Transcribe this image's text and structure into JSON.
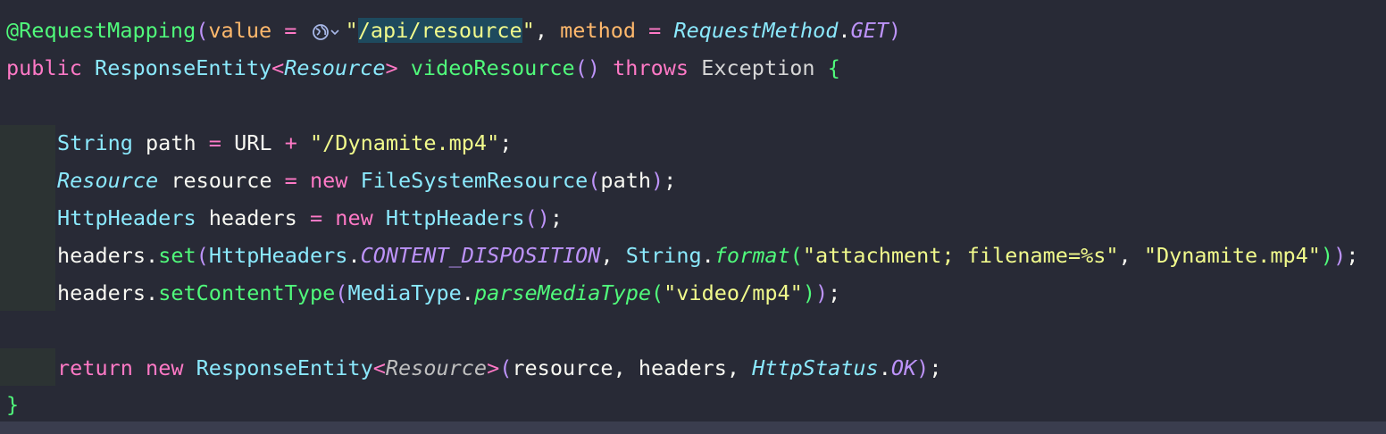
{
  "code": {
    "l1": {
      "annotation": "@RequestMapping",
      "open": "(",
      "p1": "value",
      "eq1": " = ",
      "q1": "\"",
      "path": "/api/resource",
      "q2": "\"",
      "comma": ", ",
      "p2": "method",
      "eq2": " = ",
      "enum": "RequestMethod",
      "dot": ".",
      "get": "GET",
      "close": ")"
    },
    "l2": {
      "pub": "public ",
      "resp": "ResponseEntity",
      "lt": "<",
      "res": "Resource",
      "gt": ">",
      "sp": " ",
      "name": "videoResource",
      "parens": "()",
      "throws": " throws ",
      "exc": "Exception ",
      "brace": "{"
    },
    "l3": {
      "type": "String",
      "var": " path ",
      "eq": "=",
      "url": " URL ",
      "plus": "+",
      "sp": " ",
      "str": "\"/Dynamite.mp4\"",
      "semi": ";"
    },
    "l4": {
      "type": "Resource",
      "var": " resource ",
      "eq": "=",
      "sp": " ",
      "new": "new",
      "sp2": " ",
      "cls": "FileSystemResource",
      "open": "(",
      "arg": "path",
      "close": ")",
      "semi": ";"
    },
    "l5": {
      "type": "HttpHeaders",
      "var": " headers ",
      "eq": "=",
      "sp": " ",
      "new": "new",
      "sp2": " ",
      "cls": "HttpHeaders",
      "parens": "()",
      "semi": ";"
    },
    "l6": {
      "obj": "headers",
      "dot": ".",
      "fn": "set",
      "open": "(",
      "cls": "HttpHeaders",
      "dot2": ".",
      "const": "CONTENT_DISPOSITION",
      "comma": ", ",
      "str": "String",
      "dot3": ".",
      "fmt": "format",
      "open2": "(",
      "s1": "\"attachment; filename=%s\"",
      "comma2": ", ",
      "s2": "\"Dynamite.mp4\"",
      "close2": ")",
      "close": ")",
      "semi": ";"
    },
    "l7": {
      "obj": "headers",
      "dot": ".",
      "fn": "setContentType",
      "open": "(",
      "cls": "MediaType",
      "dot2": ".",
      "pm": "parseMediaType",
      "open2": "(",
      "s1": "\"video/mp4\"",
      "close2": ")",
      "close": ")",
      "semi": ";"
    },
    "l9": {
      "ret": "return",
      "sp": " ",
      "new": "new",
      "sp2": " ",
      "cls": "ResponseEntity",
      "lt": "<",
      "gen": "Resource",
      "gt": ">",
      "open": "(",
      "args": "resource, headers, ",
      "status": "HttpStatus",
      "dot": ".",
      "ok": "OK",
      "close": ")",
      "semi": ";"
    },
    "l10": {
      "brace": "}"
    }
  },
  "colors": {
    "background": "#282a36",
    "annotation": "#50fa7b",
    "keyword": "#ff79c6",
    "string": "#f1fa8c",
    "class": "#8be9fd",
    "constant": "#bd93f9",
    "parameter": "#ffb86c"
  },
  "icons": {
    "url_hint": "globe-icon",
    "url_hint_dropdown": "chevron-down-icon"
  }
}
